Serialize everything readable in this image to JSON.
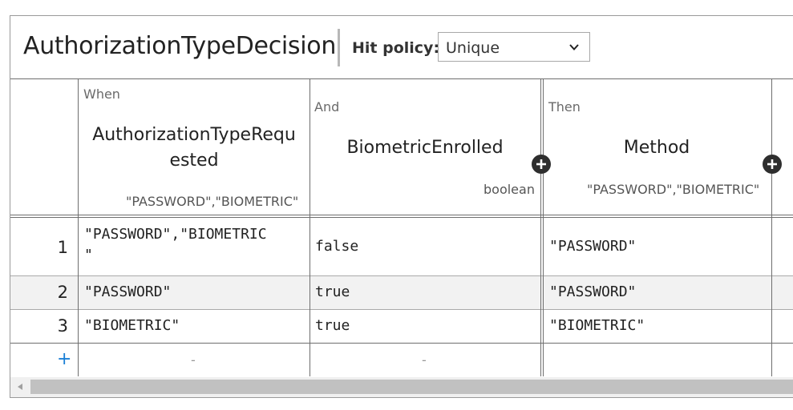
{
  "decision": {
    "title": "AuthorizationTypeDecision",
    "hit_policy_label": "Hit policy:",
    "hit_policy_value": "Unique"
  },
  "columns": [
    {
      "kind": "When",
      "name_line1": "AuthorizationTypeRequ",
      "name_line2": "ested",
      "type_ref": "\"PASSWORD\",\"BIOMETRIC\""
    },
    {
      "kind": "And",
      "name_line1": "BiometricEnrolled",
      "type_ref": "boolean"
    },
    {
      "kind": "Then",
      "name_line1": "Method",
      "type_ref": "\"PASSWORD\",\"BIOMETRIC\""
    }
  ],
  "rows": [
    {
      "num": "1",
      "c1_line1": "\"PASSWORD\",\"BIOMETRIC",
      "c1_line2": "\"",
      "c2": "false",
      "c3": "\"PASSWORD\""
    },
    {
      "num": "2",
      "c1_line1": "\"PASSWORD\"",
      "c2": "true",
      "c3": "\"PASSWORD\""
    },
    {
      "num": "3",
      "c1_line1": "\"BIOMETRIC\"",
      "c2": "true",
      "c3": "\"BIOMETRIC\""
    }
  ],
  "new_row": {
    "add_label": "+",
    "dash1": "-",
    "dash2": "-"
  },
  "icons": {
    "add_column": "plus-circle-icon",
    "select": "chevron-down-icon",
    "scroll_left": "triangle-left-icon"
  },
  "colors": {
    "accent": "#1a7fd6",
    "border": "#6e6e6e",
    "alt_row": "#f2f2f2"
  }
}
